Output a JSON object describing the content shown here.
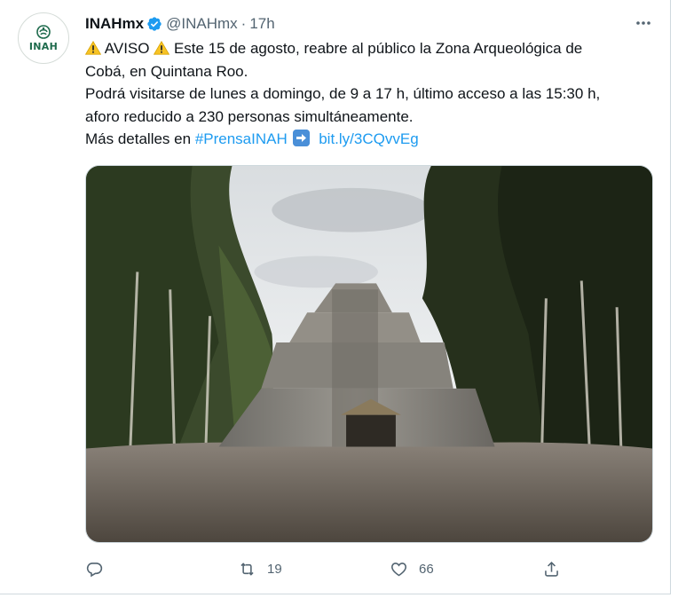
{
  "account": {
    "display_name": "INAHmx",
    "handle": "@INAHmx",
    "separator": "·",
    "time": "17h",
    "avatar_text": "INAH",
    "verified_icon": "verified-badge-icon"
  },
  "tweet": {
    "line1_a": "AVISO",
    "line1_b": "Este 15 de agosto, reabre al público la Zona Arqueológica de",
    "line2": "Cobá, en Quintana Roo.",
    "line3": "Podrá visitarse de lunes a domingo, de 9 a 17 h, último acceso a las 15:30 h,",
    "line4": "aforo reducido a 230 personas simultáneamente.",
    "line5_prefix": "Más detalles en",
    "hashtag": "#PrensaINAH",
    "short_link": "bit.ly/3CQvvEg"
  },
  "actions": {
    "reply_count": "",
    "retweet_count": "19",
    "like_count": "66",
    "share_count": ""
  },
  "colors": {
    "link": "#1d9bf0",
    "secondary_text": "#536471",
    "verified": "#1d9bf0",
    "inah_green": "#1f6b4d"
  }
}
